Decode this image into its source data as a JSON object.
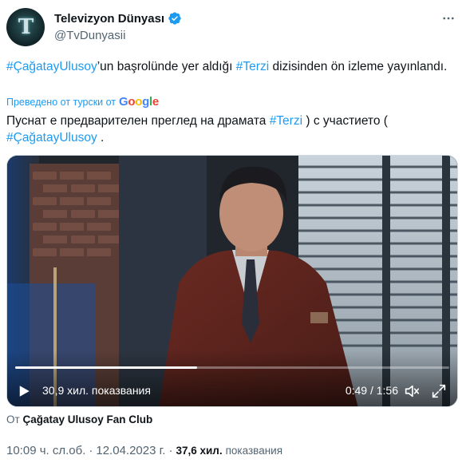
{
  "author": {
    "display_name": "Televizyon Dünyası",
    "handle": "@TvDunyasii",
    "avatar_letter": "T"
  },
  "tweet": {
    "hashtag1": "#ÇağatayUlusoy",
    "text1": "’un başrolünde yer aldığı ",
    "hashtag2": "#Terzi",
    "text2": " dizisinden ön izleme yayınlandı."
  },
  "translation": {
    "note": "Преведено от турски от",
    "provider_letters": [
      "G",
      "o",
      "o",
      "g",
      "l",
      "e"
    ],
    "text1": "Пуснат е предварителен преглед на драмата ",
    "hashtag1": "#Terzi",
    "text2": " ) с участието ( ",
    "hashtag2": "#ÇağatayUlusoy",
    "text3": " ."
  },
  "video": {
    "views": "30,9 хил. показвания",
    "current_time": "0:49",
    "separator": " / ",
    "duration": "1:56",
    "progress": 0.42
  },
  "source": {
    "prefix": "От",
    "name": "Çağatay Ulusoy Fan Club"
  },
  "meta": {
    "time": "10:09 ч. сл.об.",
    "dot": "·",
    "date": "12.04.2023 г.",
    "dot2": "·",
    "views_count": "37,6 хил.",
    "views_label": "показвания"
  },
  "colors": {
    "accent": "#1d9bf0",
    "text": "#0f1419",
    "muted": "#536471"
  },
  "icons": [
    "verified-badge-icon",
    "more-options-icon",
    "play-icon",
    "volume-icon",
    "fullscreen-icon"
  ]
}
